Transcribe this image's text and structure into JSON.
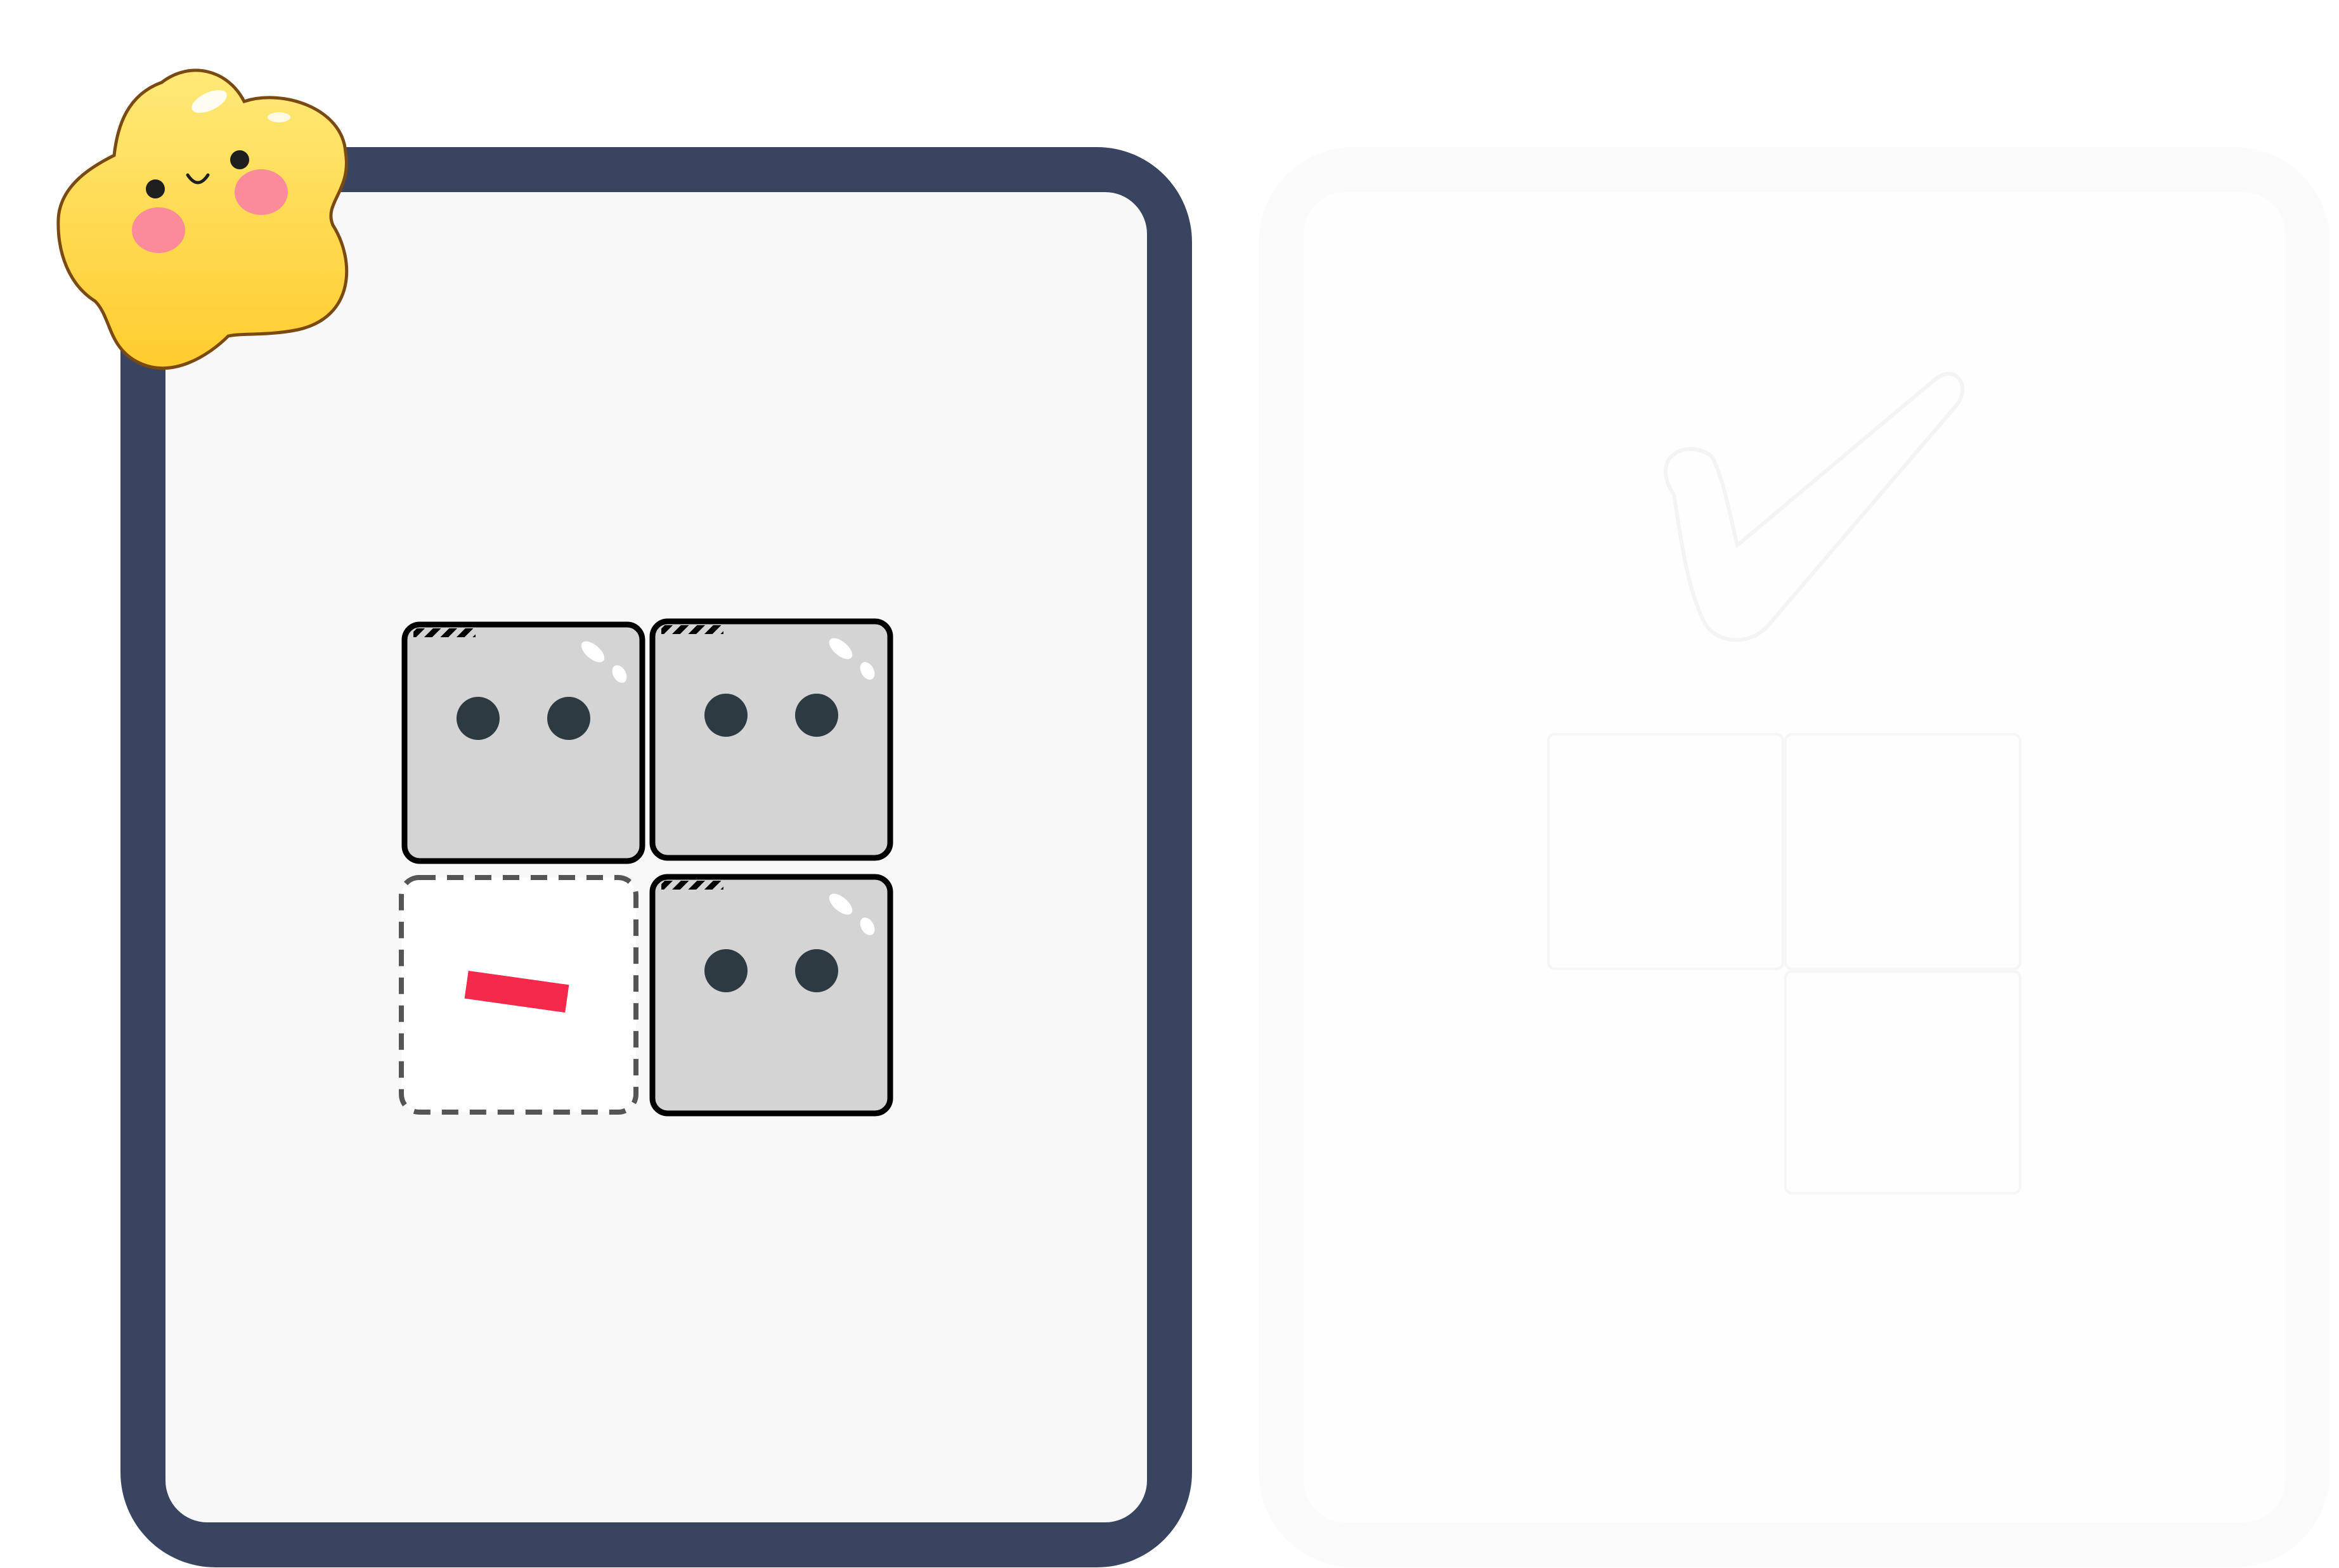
{
  "colors": {
    "page_background": "#ffffff",
    "active_card_border": "#394560",
    "active_card_fill": "#f8f8f9",
    "ghost_card_border": "#fbfbfc",
    "ghost_card_fill": "#fefefe",
    "tile_fill": "#d4d4d4",
    "tile_outline": "#000000",
    "tile_eye": "#2d3a42",
    "missing_slot_outline": "#555555",
    "wrong_mark": "#f5294c",
    "ghost_check": "#f7f7f8",
    "mascot_fill": "#ffd84a",
    "mascot_outline": "#7a4a12",
    "mascot_cheek": "#fb8a9a"
  },
  "left_card": {
    "state": "current-puzzle",
    "mascot_icon": "star-mascot-icon",
    "grid": {
      "rows": 2,
      "cols": 2,
      "cells": [
        {
          "row": 0,
          "col": 0,
          "type": "tile",
          "icon": "face-tile-icon"
        },
        {
          "row": 0,
          "col": 1,
          "type": "tile",
          "icon": "face-tile-icon"
        },
        {
          "row": 1,
          "col": 0,
          "type": "missing-slot",
          "icon": "x-mark-icon"
        },
        {
          "row": 1,
          "col": 1,
          "type": "tile",
          "icon": "face-tile-icon"
        }
      ]
    }
  },
  "right_card": {
    "state": "faded-answer",
    "icon": "checkmark-icon",
    "grid": {
      "cells": [
        {
          "row": 0,
          "col": 0,
          "type": "tile"
        },
        {
          "row": 0,
          "col": 1,
          "type": "tile"
        },
        {
          "row": 1,
          "col": 1,
          "type": "tile"
        }
      ]
    }
  }
}
